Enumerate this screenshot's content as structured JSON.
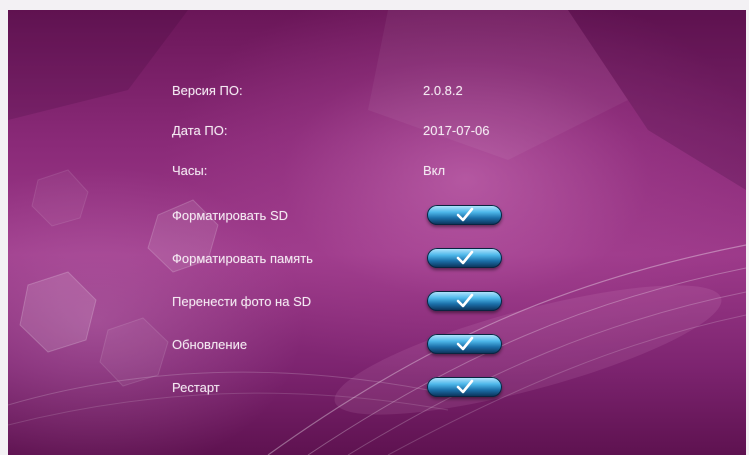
{
  "info_rows": [
    {
      "label": "Версия ПО:",
      "value": "2.0.8.2"
    },
    {
      "label": "Дата ПО:",
      "value": "2017-07-06"
    },
    {
      "label": "Часы:",
      "value": "Вкл"
    }
  ],
  "action_rows": [
    {
      "label": "Форматировать SD",
      "icon": "check-icon"
    },
    {
      "label": "Форматировать память",
      "icon": "check-icon"
    },
    {
      "label": "Перенести фото на SD",
      "icon": "check-icon"
    },
    {
      "label": "Обновление",
      "icon": "check-icon"
    },
    {
      "label": "Рестарт",
      "icon": "check-icon"
    }
  ],
  "colors": {
    "background": "#8a2a78",
    "text": "#f4e8f2",
    "button": "#2a8fd0"
  }
}
